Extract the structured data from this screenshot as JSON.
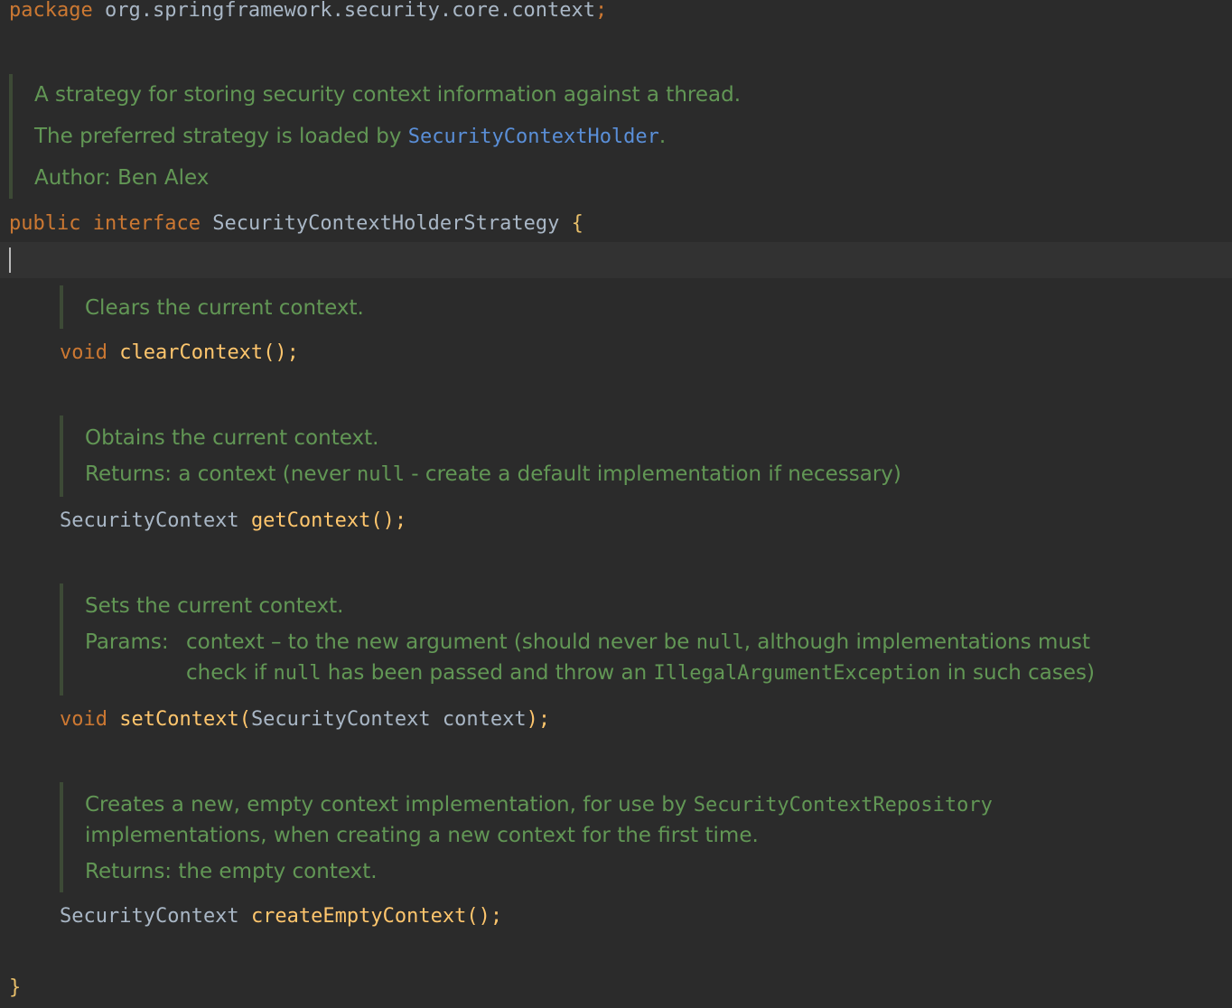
{
  "package_line": {
    "keyword": "package",
    "name": "org.springframework.security.core.context",
    "semicolon": ";"
  },
  "class_doc": {
    "line1": "A strategy for storing security context information against a thread.",
    "line2_prefix": "The preferred strategy is loaded by ",
    "line2_link": "SecurityContextHolder",
    "line2_suffix": ".",
    "author": "Author: Ben Alex"
  },
  "interface_decl": {
    "modifier": "public",
    "keyword": "interface",
    "name": "SecurityContextHolderStrategy",
    "open_brace": "{"
  },
  "methods": [
    {
      "doc_line1": "Clears the current context.",
      "return_type": "void",
      "name": "clearContext",
      "signature_tail": "();"
    },
    {
      "doc_line1": "Obtains the current context.",
      "returns_label": "Returns:",
      "returns_prefix": "a context (never ",
      "returns_code": "null",
      "returns_suffix": " - create a default implementation if necessary)",
      "return_type": "SecurityContext",
      "name": "getContext",
      "signature_tail": "();"
    },
    {
      "doc_line1": "Sets the current context.",
      "params_label": "Params:",
      "params_line1_prefix": "context – to the new argument (should never be ",
      "params_line1_code": "null",
      "params_line1_suffix": ", although implementations must",
      "params_line2_prefix": "check if ",
      "params_line2_code": "null",
      "params_line2_mid": " has been passed and throw an ",
      "params_line2_code2": "IllegalArgumentException",
      "params_line2_suffix": " in such cases)",
      "return_type": "void",
      "name": "setContext",
      "param_open": "(",
      "param_type": "SecurityContext",
      "param_name": "context",
      "param_close": ");"
    },
    {
      "doc_line1_prefix": "Creates a new, empty context implementation, for use by ",
      "doc_line1_code": "SecurityContextRepository",
      "doc_line2": "implementations, when creating a new context for the first time.",
      "returns_label": "Returns:",
      "returns_text": "the empty context.",
      "return_type": "SecurityContext",
      "name": "createEmptyContext",
      "signature_tail": "();"
    }
  ],
  "close_brace": "}",
  "colors": {
    "background": "#2b2b2b",
    "keyword": "#cc7832",
    "method": "#ffc66d",
    "text": "#a9b7c6",
    "doc": "#629755",
    "doc_link": "#5a8fd8"
  }
}
